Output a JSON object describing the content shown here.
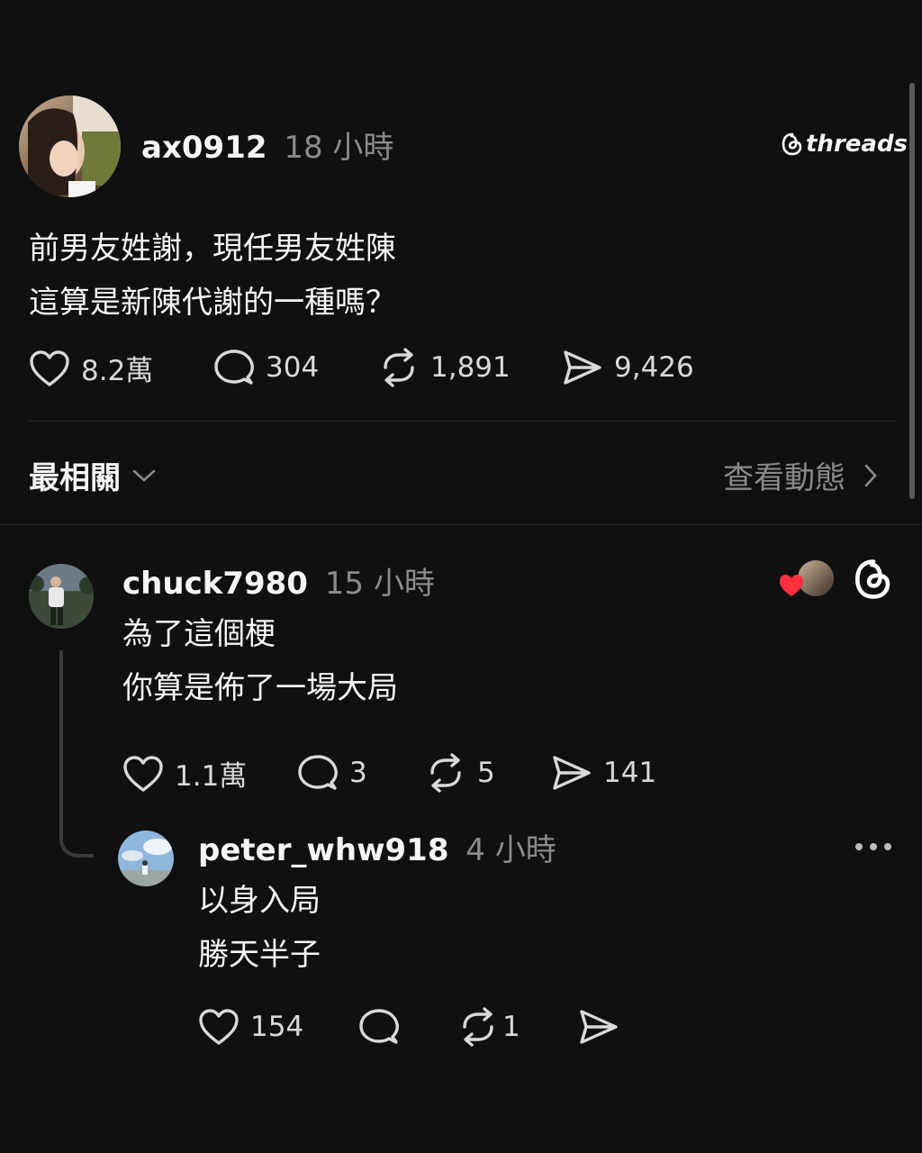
{
  "post": {
    "username": "ax0912",
    "time": "18 小時",
    "brand": "threads",
    "lines": [
      "前男友姓謝，現任男友姓陳",
      "這算是新陳代謝的一種嗎？"
    ],
    "stats": {
      "likes": "8.2萬",
      "replies": "304",
      "reposts": "1,891",
      "shares": "9,426"
    }
  },
  "sort": {
    "label": "最相關",
    "activity_link": "查看動態"
  },
  "reply": {
    "username": "chuck7980",
    "time": "15 小時",
    "lines": [
      "為了這個梗",
      "你算是佈了一場大局"
    ],
    "stats": {
      "likes": "1.1萬",
      "replies": "3",
      "reposts": "5",
      "shares": "141"
    }
  },
  "nested_reply": {
    "username": "peter_whw918",
    "time": "4 小時",
    "lines": [
      "以身入局",
      "勝天半子"
    ],
    "stats": {
      "likes": "154",
      "reposts": "1"
    }
  },
  "colors": {
    "background": "#101010",
    "text": "#f3f5f7",
    "muted": "#8a8a8a",
    "divider": "#2a2a2a",
    "like_red": "#ff3040"
  }
}
